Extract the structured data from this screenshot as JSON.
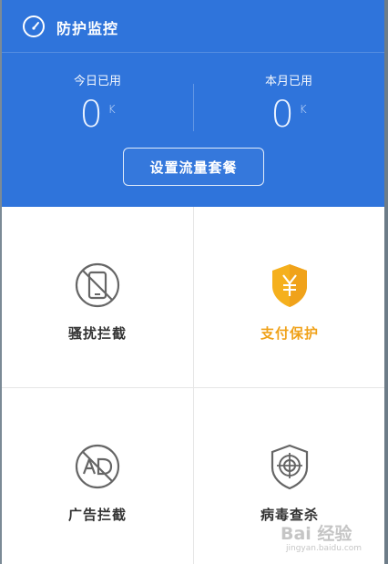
{
  "header": {
    "title": "防护监控",
    "today_label": "今日已用",
    "today_value": "0",
    "today_unit": "K",
    "month_label": "本月已用",
    "month_value": "0",
    "month_unit": "K",
    "plan_button_label": "设置流量套餐"
  },
  "features": [
    {
      "label": "骚扰拦截",
      "icon": "no-phone-icon"
    },
    {
      "label": "支付保护",
      "icon": "yuan-shield-icon"
    },
    {
      "label": "广告拦截",
      "icon": "no-ad-icon"
    },
    {
      "label": "病毒查杀",
      "icon": "target-shield-icon"
    }
  ],
  "watermark": {
    "text": "Bai 经验",
    "url": "jingyan.baidu.com"
  },
  "colors": {
    "header_bg": "#2f74db",
    "accent": "#f0a21a",
    "icon_gray": "#666666"
  }
}
